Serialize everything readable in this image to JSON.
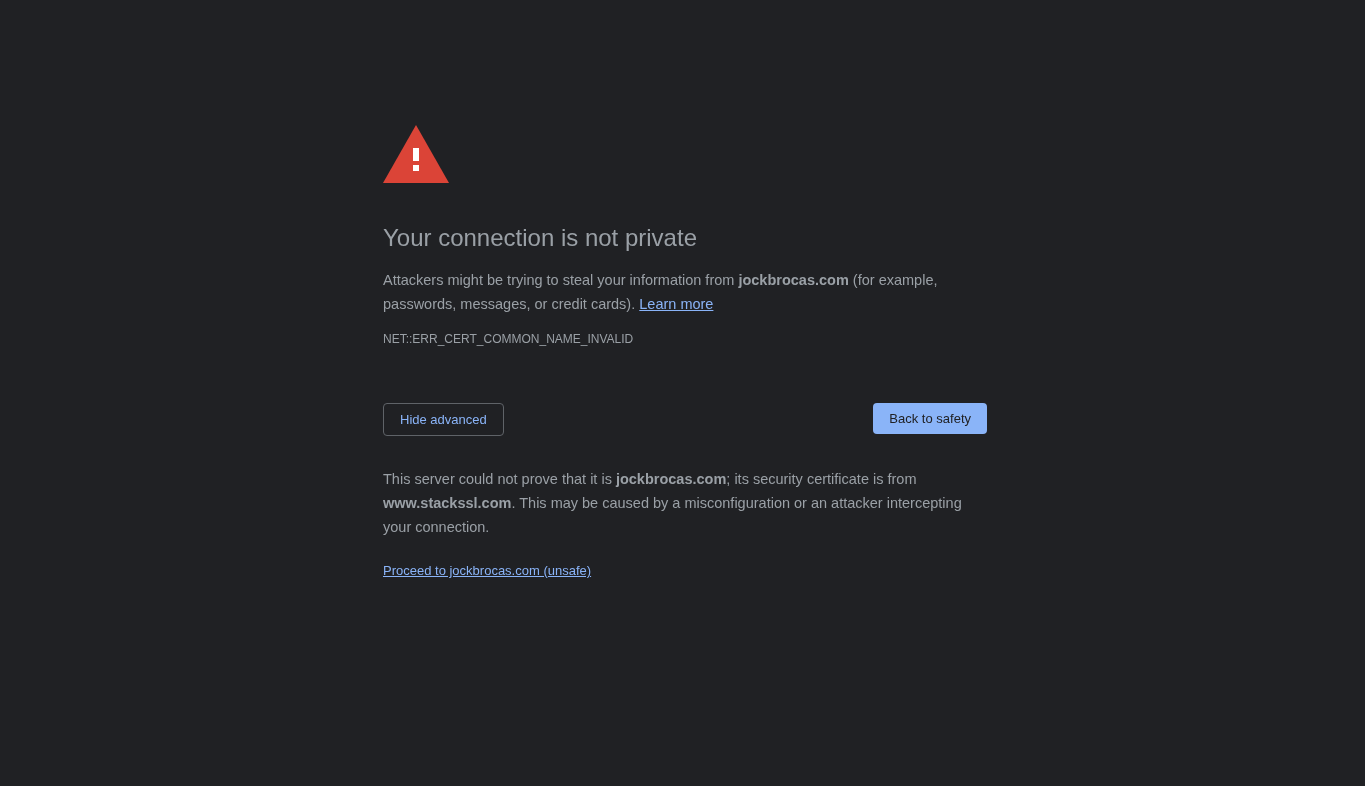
{
  "heading": "Your connection is not private",
  "intro": {
    "text": "Attackers might be trying to steal your information from **jockbrocas.com** (for example, passwords, messages, or credit cards).",
    "link": "Learn more"
  },
  "error_code": "NET::ERR_CERT_COMMON_NAME_INVALID",
  "buttons": {
    "secondary": "Hide advanced",
    "primary": "Back to safety"
  },
  "details": "This server could not prove that it is **jockbrocas.com**; its security certificate is from **www.stackssl.com**. This may be caused by a misconfiguration or an attacker intercepting your connection.",
  "proceed_link": "Proceed to jockbrocas.com (unsafe)"
}
